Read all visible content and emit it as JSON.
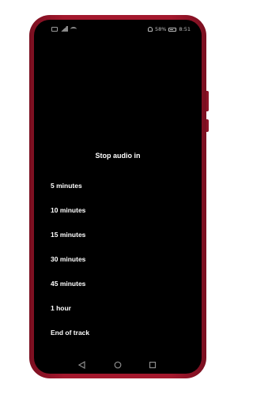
{
  "status_bar": {
    "battery_percent": "58%",
    "time": "8:51"
  },
  "sleep_timer": {
    "title": "Stop audio in",
    "options": [
      {
        "label": "5 minutes"
      },
      {
        "label": "10 minutes"
      },
      {
        "label": "15 minutes"
      },
      {
        "label": "30 minutes"
      },
      {
        "label": "45 minutes"
      },
      {
        "label": "1 hour"
      },
      {
        "label": "End of track"
      }
    ]
  },
  "nav_bar": {
    "icons": [
      "back-icon",
      "home-icon",
      "recents-icon"
    ]
  },
  "colors": {
    "phone_frame": "#a3182d",
    "screen_background": "#000000",
    "text": "#ffffff"
  }
}
